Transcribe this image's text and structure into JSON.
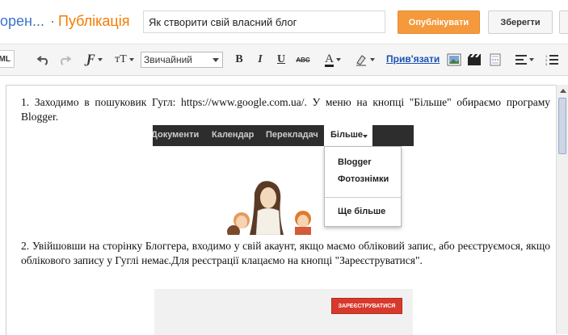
{
  "header": {
    "blog_name": "орен...",
    "separator": "·",
    "section_title": "Публікація",
    "post_title_value": "Як створити свій власний блог",
    "publish_label": "Опублікувати",
    "save_label": "Зберегти"
  },
  "toolbar": {
    "html_tab": "ML",
    "font_size_label": "тT",
    "format_select": "Звичайний",
    "bold": "B",
    "italic": "I",
    "underline": "U",
    "strike": "ABC",
    "text_color": "A",
    "link_label": "Прив'язати",
    "icons": [
      "undo-icon",
      "redo-icon",
      "font-family-icon",
      "font-size-icon",
      "text-color-icon",
      "highlight-icon",
      "image-icon",
      "video-icon",
      "jump-break-icon",
      "align-icon",
      "numbered-list-icon"
    ]
  },
  "content": {
    "p1": "1. Заходимо в пошуковик Гугл: https://www.google.com.ua/. У меню на кнопці \"Більше\" обираємо програму Blogger.",
    "p2": "2. Увійшовши на сторінку Блоггера, входимо у свій акаунт, якщо маємо обліковий запис, або реєструємося, якщо облікового запису у Гуглі немає.Для реєстрації клацаємо на кнопці \"Зареєструватися\".",
    "google_menu": {
      "nav": [
        "Документи",
        "Календар",
        "Перекладач"
      ],
      "more": "Більше",
      "dropdown": [
        "Blogger",
        "Фотознімки"
      ],
      "dropdown_more": "Ще більше"
    },
    "signup_button": "ЗАРЕЄСТРУВАТИСЯ"
  },
  "colors": {
    "accent_orange": "#f57c00",
    "publish_bg": "#f59a3c",
    "link_blue": "#1a53b5",
    "signup_red": "#d73a2c"
  }
}
